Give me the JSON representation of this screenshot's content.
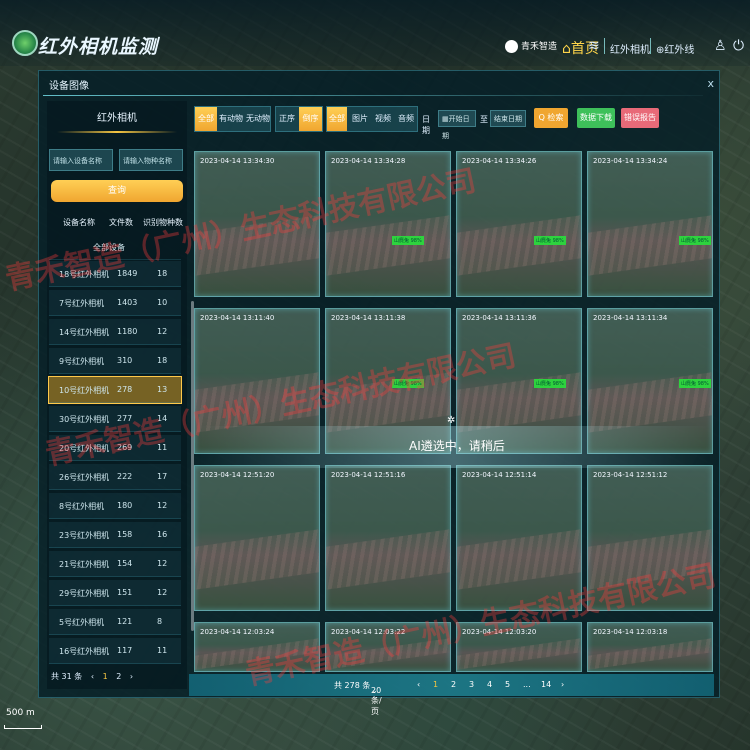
{
  "header": {
    "app_title": "红外相机监测",
    "brand_name": "青禾智造",
    "nav_home": "首页",
    "nav_camera": "红外相机",
    "nav_infrared": "红外线"
  },
  "modal": {
    "title": "设备图像",
    "close": "x"
  },
  "left_panel": {
    "title": "红外相机",
    "device_name_placeholder": "请输入设备名称",
    "species_name_placeholder": "请输入物种名称",
    "query_button": "查询",
    "columns": [
      "设备名称",
      "文件数",
      "识别物种数"
    ],
    "all_devices": "全部设备",
    "rows": [
      {
        "name": "18号红外相机",
        "files": "1849",
        "species": "18"
      },
      {
        "name": "7号红外相机",
        "files": "1403",
        "species": "10"
      },
      {
        "name": "14号红外相机",
        "files": "1180",
        "species": "12"
      },
      {
        "name": "9号红外相机",
        "files": "310",
        "species": "18"
      },
      {
        "name": "10号红外相机",
        "files": "278",
        "species": "13"
      },
      {
        "name": "30号红外相机",
        "files": "277",
        "species": "14"
      },
      {
        "name": "20号红外相机",
        "files": "269",
        "species": "11"
      },
      {
        "name": "26号红外相机",
        "files": "222",
        "species": "17"
      },
      {
        "name": "8号红外相机",
        "files": "180",
        "species": "12"
      },
      {
        "name": "23号红外相机",
        "files": "158",
        "species": "16"
      },
      {
        "name": "21号红外相机",
        "files": "154",
        "species": "12"
      },
      {
        "name": "29号红外相机",
        "files": "151",
        "species": "12"
      },
      {
        "name": "5号红外相机",
        "files": "121",
        "species": "8"
      },
      {
        "name": "16号红外相机",
        "files": "117",
        "species": "11"
      }
    ],
    "selected_row": "10号红外相机",
    "pager_total": "共 31 条",
    "pager_pages": [
      "1",
      "2"
    ],
    "pager_prev": "‹",
    "pager_next": "›"
  },
  "toolbar": {
    "animal_filter": [
      "全部",
      "有动物",
      "无动物"
    ],
    "sort": [
      "正序",
      "倒序"
    ],
    "media_type": [
      "全部",
      "图片",
      "视频",
      "音频"
    ],
    "date_label": "日期",
    "date_start_placeholder": "开始日期",
    "date_to": "至",
    "date_end_placeholder": "结束日期",
    "search_button": "Q 检索",
    "download_button": "数据下载",
    "report_button": "错误报告"
  },
  "images": [
    {
      "time": "2023-04-14 13:34:30",
      "tag": ""
    },
    {
      "time": "2023-04-14 13:34:28",
      "tag": "山麂兔 98%"
    },
    {
      "time": "2023-04-14 13:34:26",
      "tag": "山麂兔 98%"
    },
    {
      "time": "2023-04-14 13:34:24",
      "tag": "山麂兔 98%"
    },
    {
      "time": "2023-04-14 13:11:40",
      "tag": ""
    },
    {
      "time": "2023-04-14 13:11:38",
      "tag": "山麂兔 98%"
    },
    {
      "time": "2023-04-14 13:11:36",
      "tag": "山麂兔 98%"
    },
    {
      "time": "2023-04-14 13:11:34",
      "tag": "山麂兔 98%"
    },
    {
      "time": "2023-04-14 12:51:20",
      "tag": ""
    },
    {
      "time": "2023-04-14 12:51:16",
      "tag": ""
    },
    {
      "time": "2023-04-14 12:51:14",
      "tag": ""
    },
    {
      "time": "2023-04-14 12:51:12",
      "tag": ""
    },
    {
      "time": "2023-04-14 12:03:24",
      "tag": ""
    },
    {
      "time": "2023-04-14 12:03:22",
      "tag": ""
    },
    {
      "time": "2023-04-14 12:03:20",
      "tag": ""
    },
    {
      "time": "2023-04-14 12:03:18",
      "tag": ""
    }
  ],
  "loading_text": "AI遴选中，请稍后",
  "pager": {
    "total": "共 278 条",
    "page_size": "20条/页",
    "prev": "‹",
    "pages": [
      "1",
      "2",
      "3",
      "4",
      "5",
      "...",
      "14"
    ],
    "next": "›"
  },
  "map_scale": "500 m",
  "watermark": [
    "青禾智造（广州）生态科技有限公司",
    "青禾智造（广州）生态科技有限公司",
    "青禾智造（广州）生态科技有限公司"
  ]
}
